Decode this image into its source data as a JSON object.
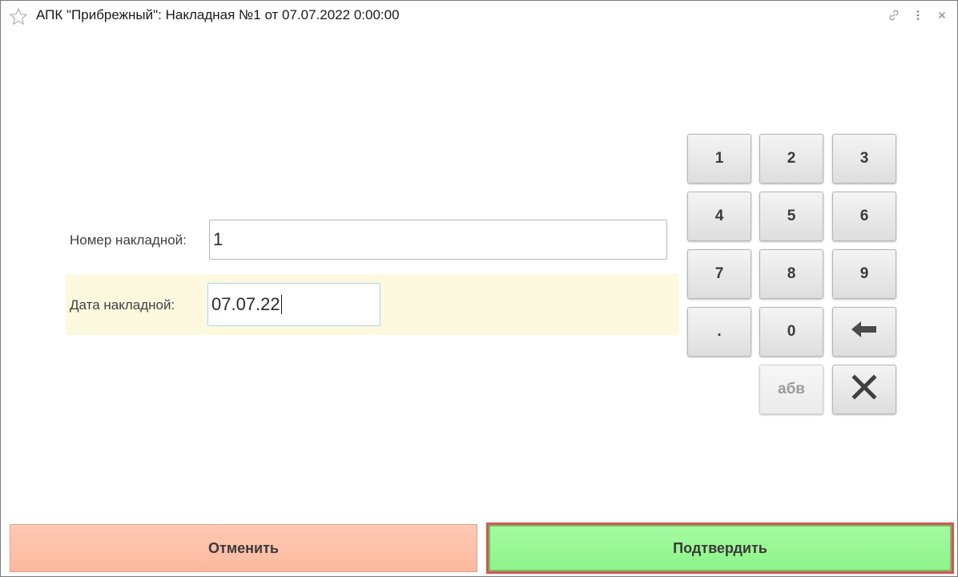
{
  "window": {
    "title": "АПК \"Прибрежный\": Накладная №1 от 07.07.2022 0:00:00",
    "controls": [
      "link-icon",
      "more-icon",
      "close-icon"
    ]
  },
  "form": {
    "number_label": "Номер накладной:",
    "number_value": "1",
    "date_label": "Дата накладной:",
    "date_value": "07.07.22",
    "highlight_color": "#fdf9de"
  },
  "keypad": {
    "keys": [
      "1",
      "2",
      "3",
      "4",
      "5",
      "6",
      "7",
      "8",
      "9",
      ".",
      "0"
    ],
    "backspace_icon": "backspace-arrow-icon",
    "alpha_label": "абв",
    "clear_icon": "clear-x-icon"
  },
  "footer": {
    "cancel_label": "Отменить",
    "confirm_label": "Подтвердить",
    "cancel_color": "#fbb99e",
    "confirm_color": "#8ef38a",
    "confirm_outline_color": "#d9534f"
  }
}
